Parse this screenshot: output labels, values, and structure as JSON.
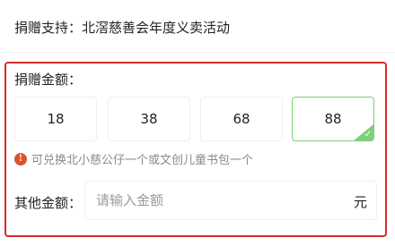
{
  "support": {
    "label": "捐赠支持：",
    "value": "北滘慈善会年度义卖活动"
  },
  "amount": {
    "title": "捐赠金额：",
    "options": [
      "18",
      "38",
      "68",
      "88"
    ],
    "selected": "88",
    "hint": "可兑换北小慈公仔一个或文创儿童书包一个"
  },
  "other_amount": {
    "label": "其他金额：",
    "placeholder": "请输入金额",
    "value": "",
    "unit": "元"
  },
  "colors": {
    "highlight_border": "#d72a2a",
    "selected_accent": "#7fcf7a",
    "info_icon": "#d9552b"
  },
  "icons": {
    "hint": "info-icon",
    "selected": "check-icon"
  }
}
